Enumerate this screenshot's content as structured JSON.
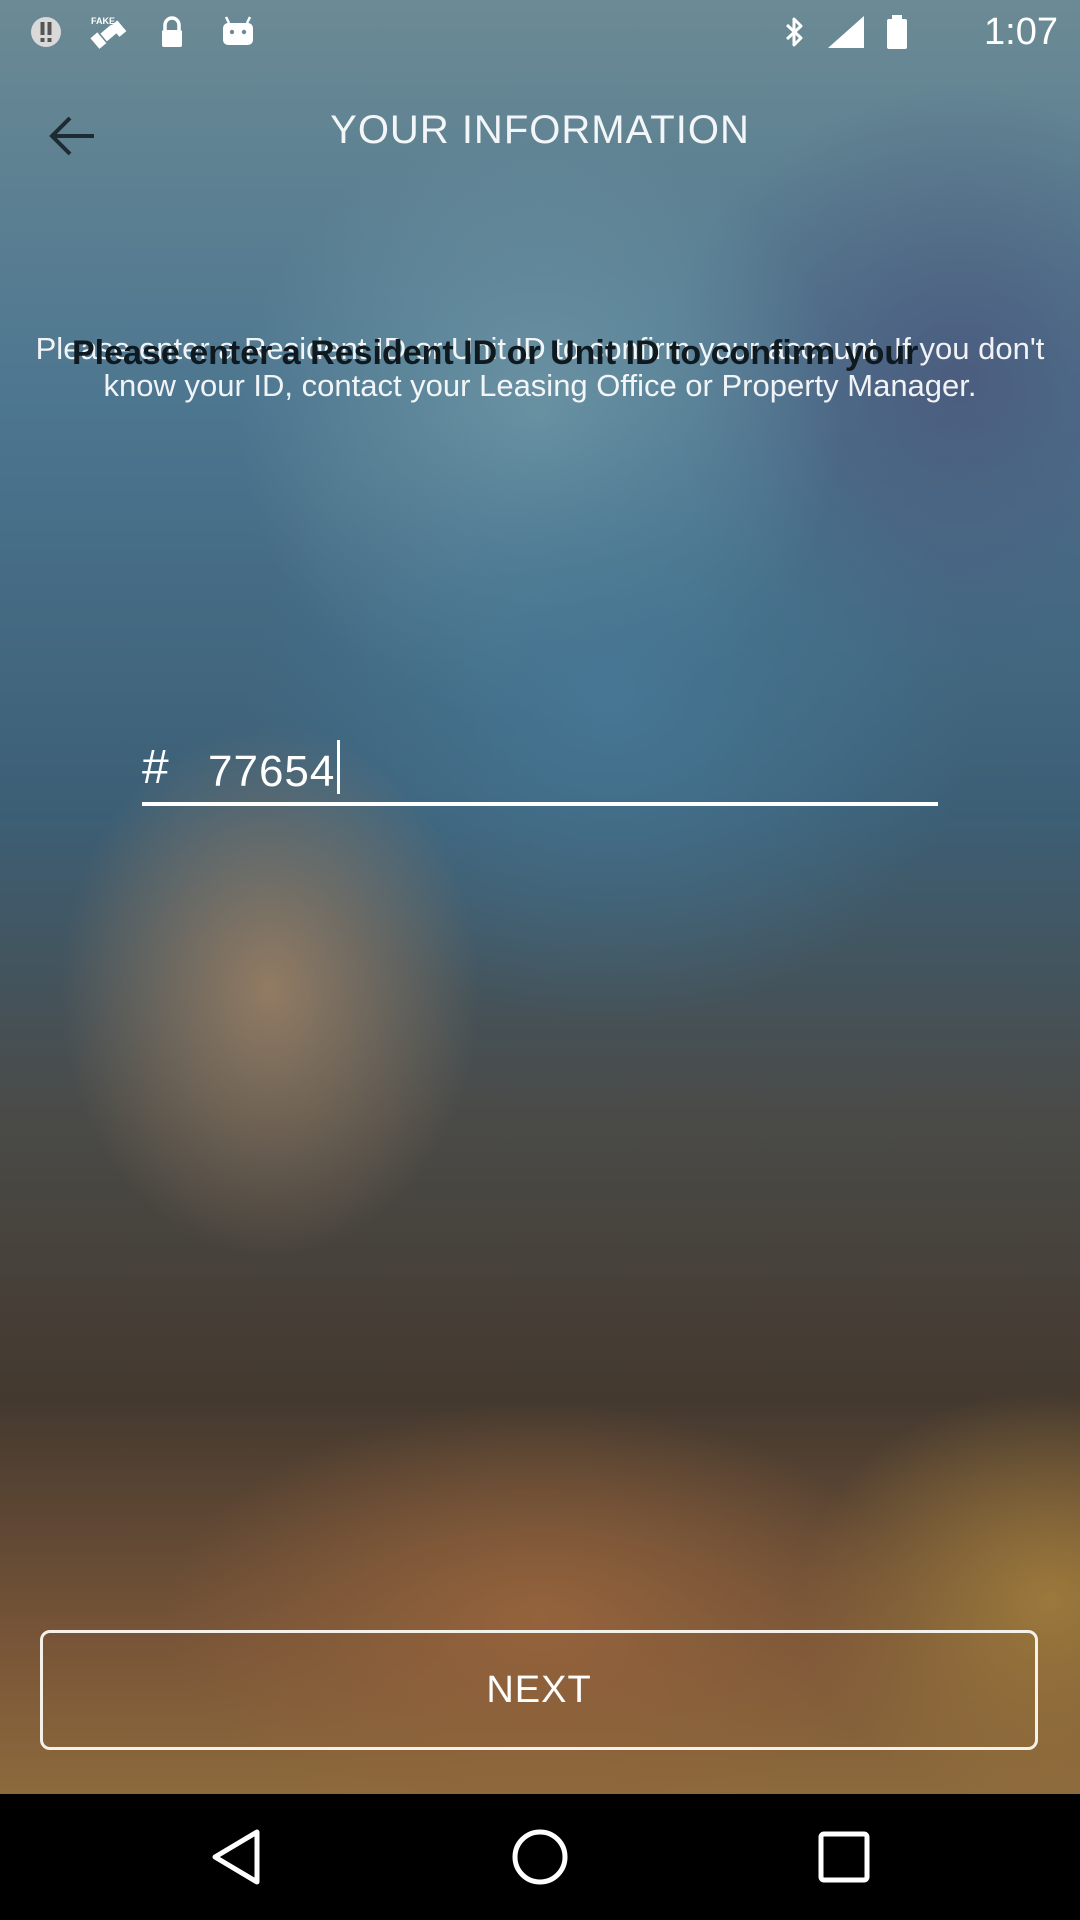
{
  "status_bar": {
    "time": "1:07",
    "icons": [
      "alert-circle-icon",
      "fake-gps-satellite-icon",
      "lock-icon",
      "android-icon",
      "bluetooth-icon",
      "signal-icon",
      "battery-icon"
    ]
  },
  "header": {
    "back_icon": "arrow-left-icon",
    "title": "YOUR INFORMATION"
  },
  "description": {
    "text": "Please enter a Resident ID or Unit ID to confirm your account. If you don't know your ID, contact your Leasing Office or Property Manager.",
    "bold_overlay": "Please enter a Resident ID or Unit ID to confirm your"
  },
  "id_input": {
    "prefix": "#",
    "value": "77654"
  },
  "next_button": {
    "label": "NEXT"
  },
  "nav_bar": {
    "icons": [
      "back-triangle-icon",
      "home-circle-icon",
      "recents-square-icon"
    ]
  },
  "colors": {
    "text_light": "#ffffff",
    "bold_text": "#0f1a20",
    "nav_bg": "#000000"
  }
}
